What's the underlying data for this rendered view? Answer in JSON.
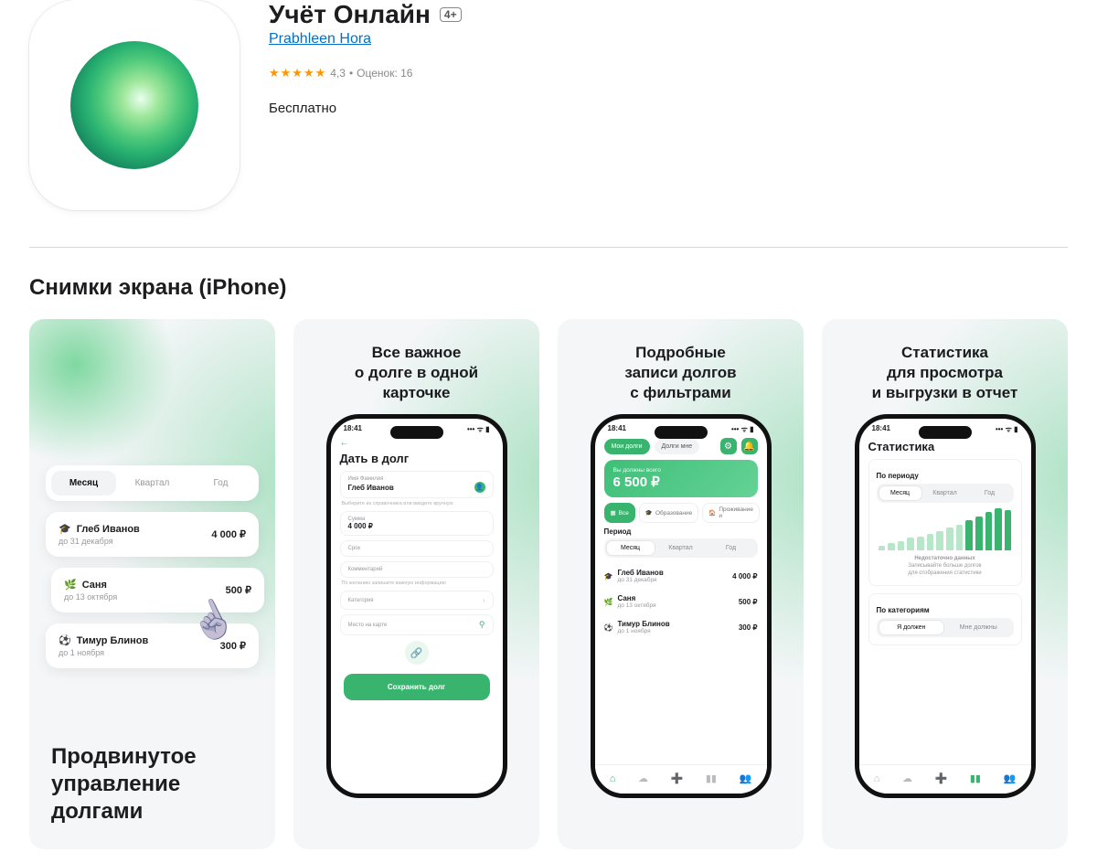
{
  "header": {
    "app_name": "Учёт Онлайн",
    "age_rating": "4+",
    "developer": "Prabhleen Hora",
    "rating_value": "4,3",
    "rating_count_label": "Оценок: 16",
    "price": "Бесплатно",
    "stars_glyph": "★★★★★"
  },
  "screenshots_heading": "Снимки экрана (iPhone)",
  "status_bar": {
    "time": "18:41"
  },
  "card1": {
    "tabs": [
      "Месяц",
      "Квартал",
      "Год"
    ],
    "items": [
      {
        "name": "Глеб Иванов",
        "due": "до 31 декабря",
        "amount": "4 000 ₽"
      },
      {
        "name": "Саня",
        "due": "до 13 октября",
        "amount": "500 ₽"
      },
      {
        "name": "Тимур Блинов",
        "due": "до 1 ноября",
        "amount": "300 ₽"
      }
    ],
    "caption_l1": "Продвинутое",
    "caption_l2": "управление",
    "caption_l3": "долгами"
  },
  "card2": {
    "title_l1": "Все важное",
    "title_l2": "о долге в одной",
    "title_l3": "карточке",
    "screen_title": "Дать в долг",
    "field_name_label": "Имя Фамилия",
    "field_name_value": "Глеб Иванов",
    "field_name_hint": "Выберите из справочника или введите вручную",
    "field_sum_label": "Сумма",
    "field_sum_value": "4 000 ₽",
    "field_due_label": "Срок",
    "field_comment_label": "Комментарий",
    "field_comment_hint": "По желанию запишите важную информацию",
    "field_category_label": "Категория",
    "field_map_label": "Место на карте",
    "save_button": "Сохранить долг"
  },
  "card3": {
    "title_l1": "Подробные",
    "title_l2": "записи долгов",
    "title_l3": "с фильтрами",
    "tab_my": "Мои долги",
    "tab_to_me": "Долги мне",
    "total_label": "Вы должны всего",
    "total_value": "6 500 ₽",
    "filter_all": "Все",
    "filter_edu": "Образование",
    "filter_live": "Проживание и",
    "period_label": "Период",
    "tabs": [
      "Месяц",
      "Квартал",
      "Год"
    ],
    "items": [
      {
        "name": "Глеб Иванов",
        "due": "до 31 декабря",
        "amount": "4 000 ₽"
      },
      {
        "name": "Саня",
        "due": "до 13 октября",
        "amount": "500 ₽"
      },
      {
        "name": "Тимур Блинов",
        "due": "до 1 ноября",
        "amount": "300 ₽"
      }
    ]
  },
  "card4": {
    "title_l1": "Статистика",
    "title_l2": "для просмотра",
    "title_l3": "и выгрузки в отчет",
    "screen_title": "Статистика",
    "by_period": "По периоду",
    "tabs": [
      "Месяц",
      "Квартал",
      "Год"
    ],
    "empty_title": "Недостаточно данных",
    "empty_sub1": "Записывайте больше долгов",
    "empty_sub2": "для отображения статистики",
    "by_category": "По категориям",
    "cat_tab_owe": "Я должен",
    "cat_tab_owed": "Мне должны"
  },
  "chart_data": {
    "type": "bar",
    "note": "Heights are visual approximations (%) — numeric axis not shown in source image.",
    "values_pct": [
      12,
      18,
      22,
      30,
      34,
      40,
      46,
      54,
      62,
      72,
      82,
      92,
      100,
      96
    ]
  }
}
